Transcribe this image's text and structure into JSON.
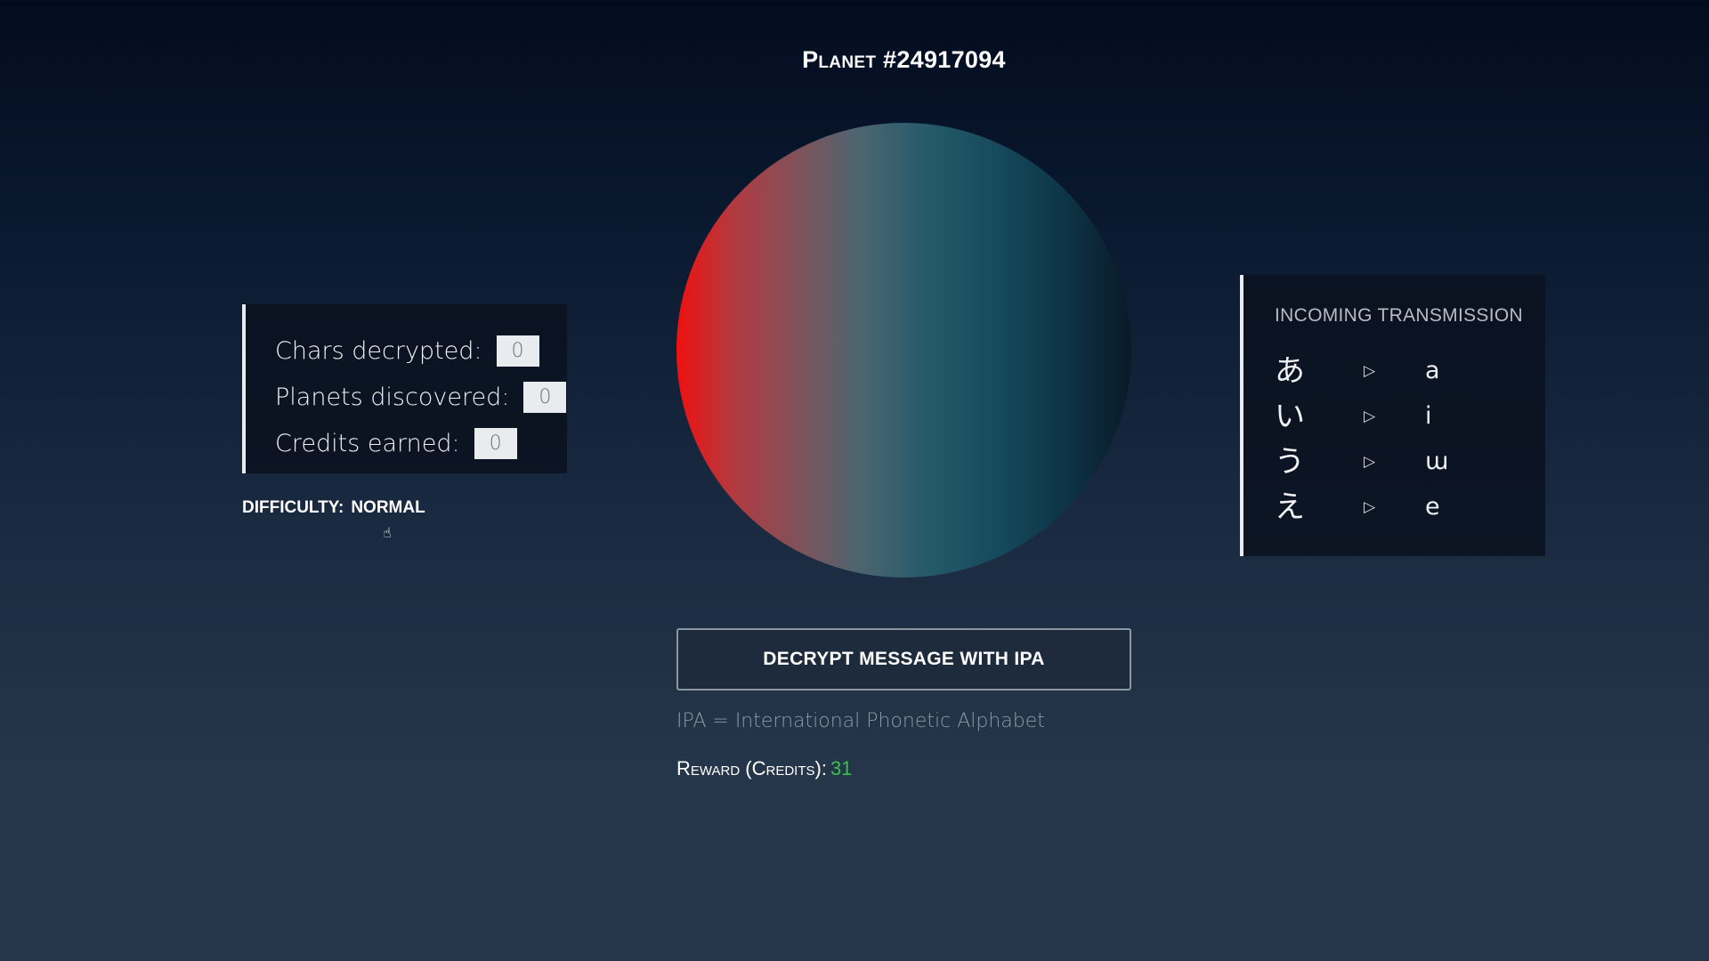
{
  "title": "Planet #24917094",
  "stats": [
    {
      "label": "Chars decrypted:",
      "value": "0"
    },
    {
      "label": "Planets discovered:",
      "value": "0"
    },
    {
      "label": "Credits earned:",
      "value": "0"
    }
  ],
  "difficulty": {
    "label": "DIFFICULTY:",
    "value": "NORMAL"
  },
  "transmission": {
    "title": "INCOMING TRANSMISSION",
    "rows": [
      {
        "glyph": "あ",
        "arrow": "▷",
        "ipa": "a"
      },
      {
        "glyph": "い",
        "arrow": "▷",
        "ipa": "i"
      },
      {
        "glyph": "う",
        "arrow": "▷",
        "ipa": "ɯ"
      },
      {
        "glyph": "え",
        "arrow": "▷",
        "ipa": "e"
      }
    ]
  },
  "decrypt_button": "DECRYPT MESSAGE WITH IPA",
  "ipa_note": "IPA = International Phonetic Alphabet",
  "reward": {
    "label": "Reward (Credits):",
    "value": "31"
  },
  "colors": {
    "reward_value": "#37c24a",
    "planet_left": "#f01010",
    "planet_right": "#0a1a28"
  }
}
